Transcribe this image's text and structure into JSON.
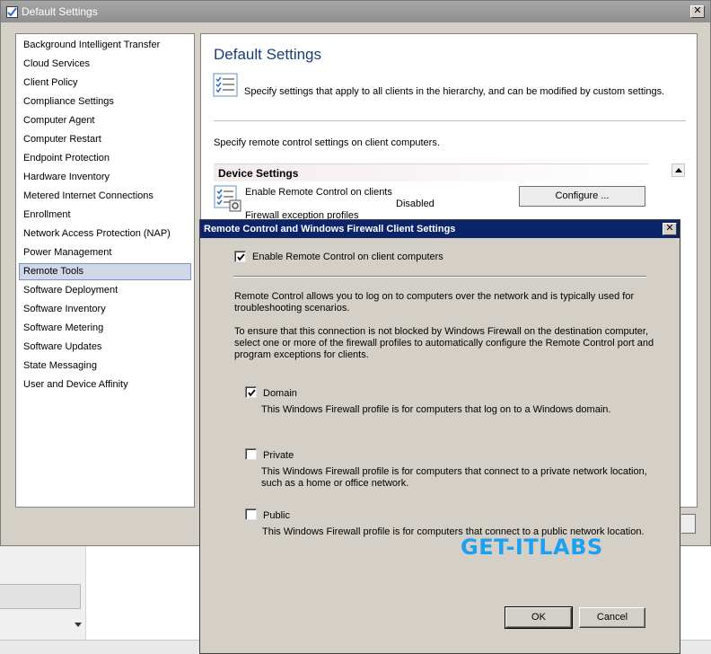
{
  "outer_window": {
    "title": "Default Settings",
    "close_glyph": "✕"
  },
  "nav": {
    "items": [
      "Background Intelligent Transfer",
      "Cloud Services",
      "Client Policy",
      "Compliance Settings",
      "Computer Agent",
      "Computer Restart",
      "Endpoint Protection",
      "Hardware Inventory",
      "Metered Internet Connections",
      "Enrollment",
      "Network Access Protection (NAP)",
      "Power Management",
      "Remote Tools",
      "Software Deployment",
      "Software Inventory",
      "Software Metering",
      "Software Updates",
      "State Messaging",
      "User and Device Affinity"
    ],
    "selected": "Remote Tools"
  },
  "content": {
    "heading": "Default Settings",
    "description": "Specify settings that apply to all clients in the hierarchy, and can be modified by custom settings.",
    "instruction": "Specify remote control settings on client computers.",
    "group_header": "Device Settings",
    "setting_label": "Enable Remote Control on clients",
    "setting_value": "Disabled",
    "setting_label_2": "Firewall exception profiles",
    "configure_button": "Configure ..."
  },
  "dialog": {
    "title": "Remote Control and Windows Firewall Client Settings",
    "close_glyph": "✕",
    "enable_checkbox": {
      "label": "Enable Remote Control on client computers",
      "checked": true
    },
    "paragraph_1_line_1": "Remote Control allows you to log on to computers over the network and is typically used for",
    "paragraph_1_line_2": "troubleshooting scenarios.",
    "paragraph_2_line_1": "To ensure that this connection is not blocked by Windows Firewall on the destination computer,",
    "paragraph_2_line_2": "select one or more of the firewall profiles to automatically configure the Remote Control port and",
    "paragraph_2_line_3": "program exceptions for clients.",
    "profiles": {
      "domain": {
        "label": "Domain",
        "checked": true,
        "desc_line_1": "This Windows Firewall profile is for computers that log on to a Windows domain."
      },
      "private": {
        "label": "Private",
        "checked": false,
        "desc_line_1": "This Windows Firewall profile is for computers that connect to a private network location,",
        "desc_line_2": "such as a home or office network."
      },
      "public": {
        "label": "Public",
        "checked": false,
        "desc_line_1": "This Windows Firewall profile is for computers that connect to a public network location."
      }
    },
    "ok_button": "OK",
    "cancel_button": "Cancel"
  },
  "watermark": "GET-ITLABS",
  "colors": {
    "dialog_titlebar": "#0a246a",
    "heading": "#1a3d7a",
    "watermark": "#1ea0f0",
    "selection": "#cfd7e8"
  },
  "icons": [
    "settings-checklist-icon",
    "window-check-icon",
    "checkmark-icon",
    "close-icon",
    "scroll-up-arrow-icon",
    "dropdown-arrow-icon"
  ]
}
